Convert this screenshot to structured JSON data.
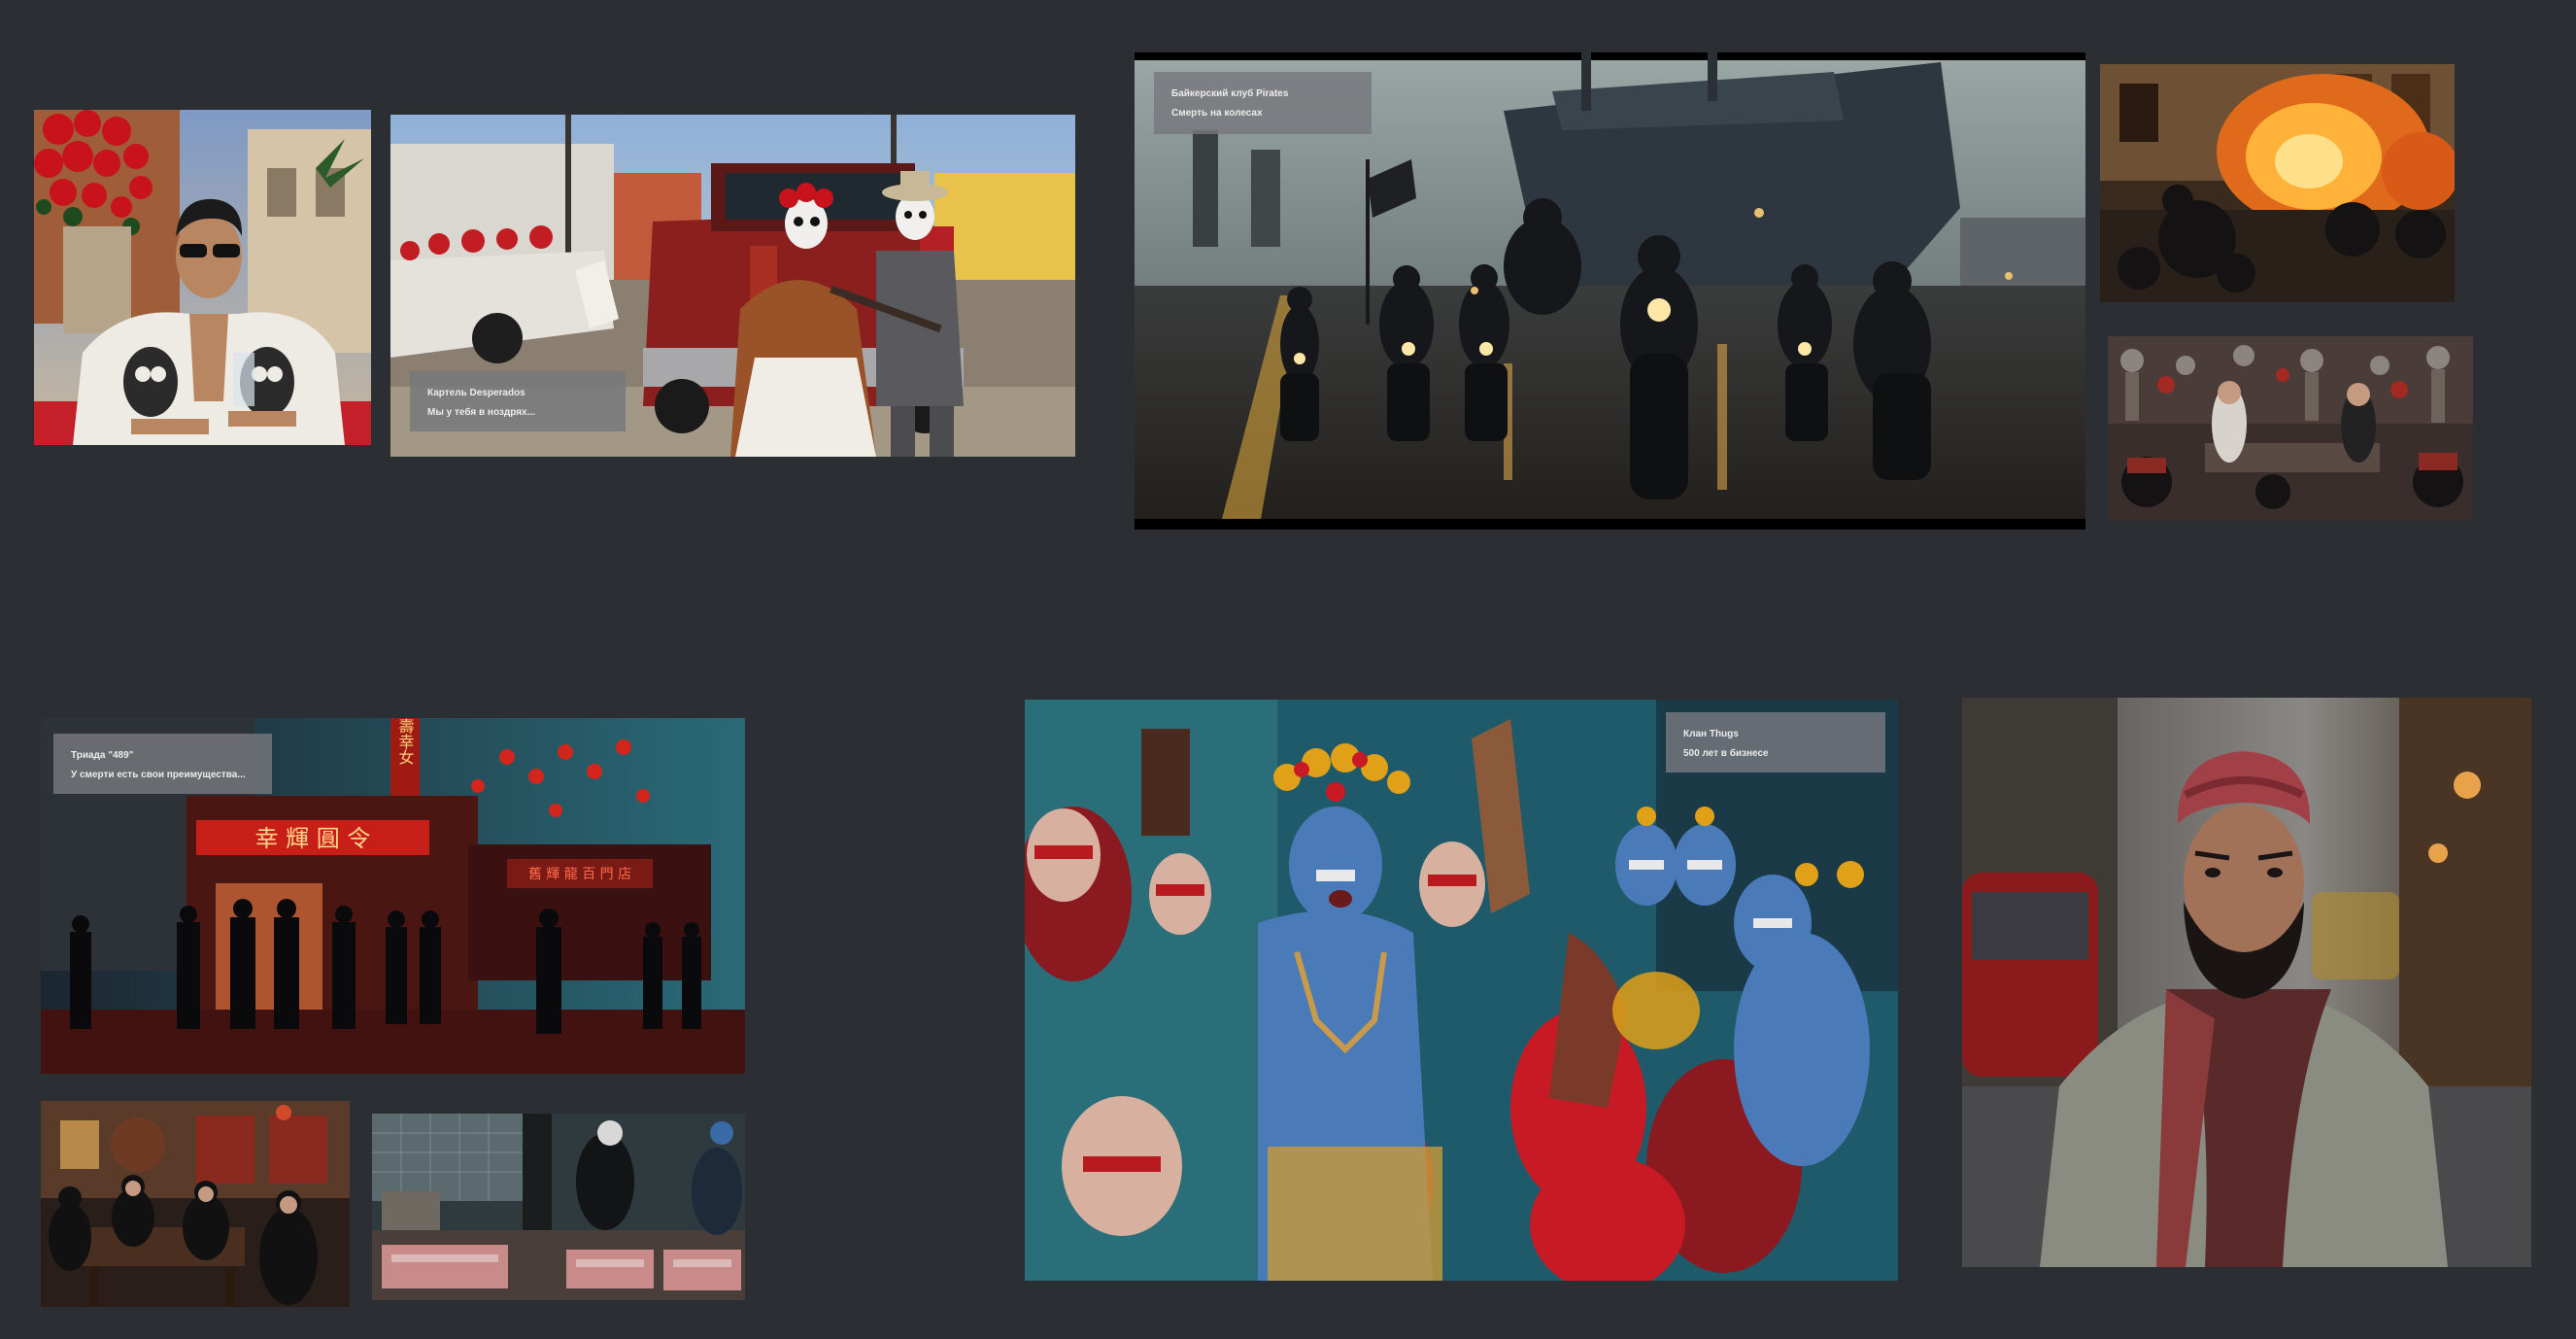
{
  "gallery": {
    "images": [
      {
        "key": "skull-jacket-man",
        "alt": "Man in skull-print jacket with roses"
      },
      {
        "key": "desperados-truck",
        "alt": "Two figures in skull makeup on a pickup truck"
      },
      {
        "key": "pirates-bikers",
        "alt": "Motorcycle gang riding by a harbor ship"
      },
      {
        "key": "burning-street",
        "alt": "Motorcycles in a burning street"
      },
      {
        "key": "skeleton-workshop",
        "alt": "Men in a workshop with skeletons and motorcycles"
      },
      {
        "key": "triad-street",
        "alt": "Men in suits on a neon-lit Chinese street"
      },
      {
        "key": "mahjong-room",
        "alt": "Group at a table in a red-lit room"
      },
      {
        "key": "fish-market",
        "alt": "Workers at a fish market"
      },
      {
        "key": "thugs-ritual",
        "alt": "Crowd with blue painted faces"
      },
      {
        "key": "turban-man",
        "alt": "Bearded man in turban on a city street"
      }
    ]
  },
  "captions": {
    "desperados": {
      "title": "Картель Desperados",
      "subtitle": "Мы у тебя в ноздрях..."
    },
    "pirates": {
      "title": "Байкерский клуб Pirates",
      "subtitle": "Смерть на колесах"
    },
    "triad": {
      "title": "Триада \"489\"",
      "subtitle": "У смерти есть свои преимущества..."
    },
    "thugs": {
      "title": "Клан Thugs",
      "subtitle": "500 лет в бизнесе"
    }
  },
  "signs": {
    "triad_main": "幸 輝 圓 令",
    "triad_vertical": "壽幸女",
    "triad_side": "舊 輝 龍 百 門 店"
  },
  "colors": {
    "background": "#2b2e33",
    "caption_bg": "#76787c",
    "caption_text": "#ececec"
  }
}
